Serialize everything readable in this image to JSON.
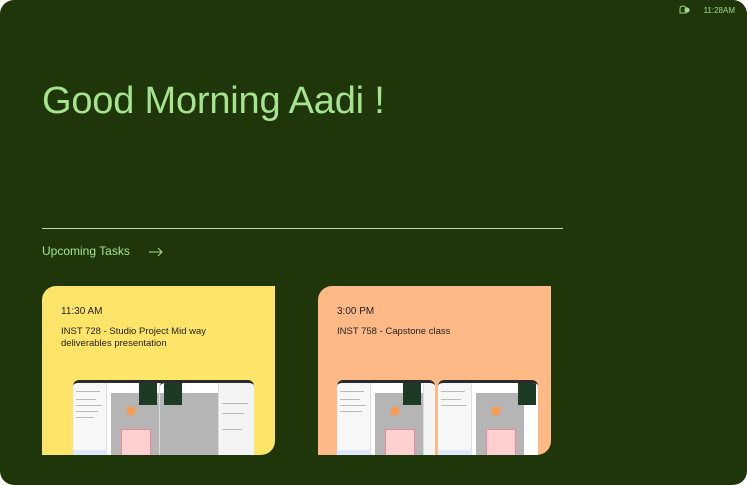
{
  "status": {
    "icon": "notification-bell-icon",
    "time": "11:28AM",
    "accent": "#9fd98d"
  },
  "greeting": "Good Morning Aadi !",
  "upcoming": {
    "label": "Upcoming Tasks",
    "arrow_icon": "arrow-right-icon"
  },
  "tasks": [
    {
      "time": "11:30 AM",
      "title": "INST 728 - Studio Project Mid way deliverables presentation",
      "color": "#ffe46a"
    },
    {
      "time": "3:00 PM",
      "title": "INST 758 - Capstone class",
      "color": "#ffb987"
    }
  ],
  "colors": {
    "background": "#1f360b",
    "greeting": "#a6e38f"
  }
}
